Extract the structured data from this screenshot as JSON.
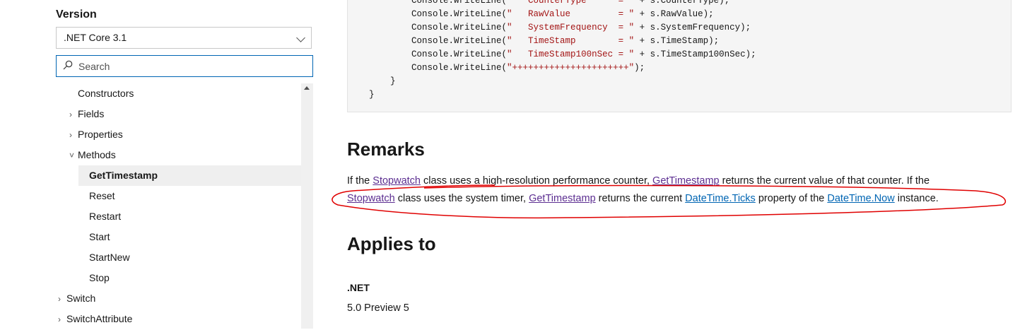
{
  "sidebar": {
    "version_label": "Version",
    "version_value": ".NET Core 3.1",
    "search_placeholder": "Search",
    "tree": [
      {
        "label": "Constructors",
        "caret": ""
      },
      {
        "label": "Fields",
        "caret": "›"
      },
      {
        "label": "Properties",
        "caret": "›"
      },
      {
        "label": "Methods",
        "caret": "˅"
      },
      {
        "label": "GetTimestamp",
        "caret": ""
      },
      {
        "label": "Reset",
        "caret": ""
      },
      {
        "label": "Restart",
        "caret": ""
      },
      {
        "label": "Start",
        "caret": ""
      },
      {
        "label": "StartNew",
        "caret": ""
      },
      {
        "label": "Stop",
        "caret": ""
      },
      {
        "label": "Switch",
        "caret": "›"
      },
      {
        "label": "SwitchAttribute",
        "caret": "›"
      }
    ]
  },
  "code": [
    {
      "pre": "            Console.WriteLine(",
      "str": "\"   CounterType      = \"",
      "post": " + s.CounterType);"
    },
    {
      "pre": "            Console.WriteLine(",
      "str": "\"   RawValue         = \"",
      "post": " + s.RawValue);"
    },
    {
      "pre": "            Console.WriteLine(",
      "str": "\"   SystemFrequency  = \"",
      "post": " + s.SystemFrequency);"
    },
    {
      "pre": "            Console.WriteLine(",
      "str": "\"   TimeStamp        = \"",
      "post": " + s.TimeStamp);"
    },
    {
      "pre": "            Console.WriteLine(",
      "str": "\"   TimeStamp100nSec = \"",
      "post": " + s.TimeStamp100nSec);"
    },
    {
      "pre": "            Console.WriteLine(",
      "str": "\"++++++++++++++++++++++\"",
      "post": ");"
    },
    {
      "pre": "        }",
      "str": "",
      "post": ""
    },
    {
      "pre": "    }",
      "str": "",
      "post": ""
    }
  ],
  "remarks": {
    "title": "Remarks",
    "line1": {
      "t1": "If the ",
      "link1": "Stopwatch",
      "t2": " class uses a high-resolution performance counter, ",
      "link2": "GetTimestamp",
      "t3": " returns the current value of that counter. If the"
    },
    "line2": {
      "link1": "Stopwatch",
      "t1": " class uses the system timer, ",
      "link2": "GetTimestamp",
      "t2": " returns the current ",
      "link3": "DateTime.Ticks",
      "t3": " property of the ",
      "link4": "DateTime.Now",
      "t4": " instance."
    }
  },
  "applies_to": {
    "title": "Applies to",
    "product": ".NET",
    "versions": "5.0 Preview 5"
  },
  "colors": {
    "visited_link": "#5c2e91",
    "link": "#0065b3",
    "annotation": "#e00000"
  }
}
